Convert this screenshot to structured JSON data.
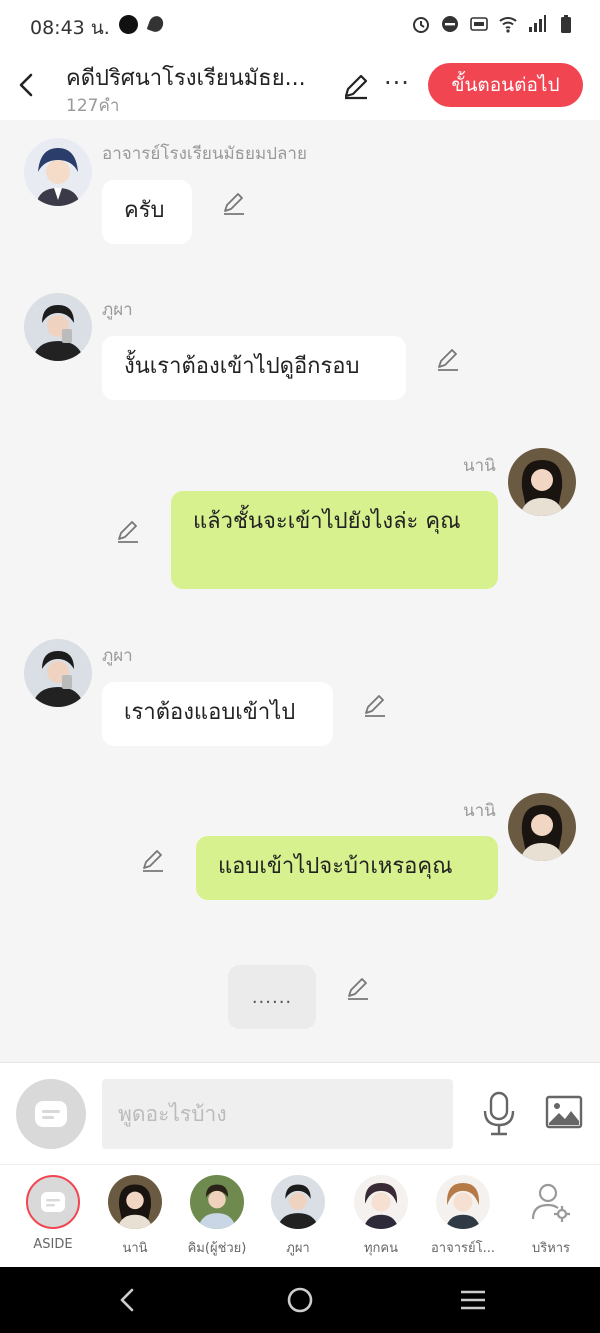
{
  "status": {
    "time": "08:43 น."
  },
  "header": {
    "title": "คดีปริศนาโรงเรียนมัธย...",
    "word_count": "127คำ",
    "next_label": "ขั้นตอนต่อไป"
  },
  "messages": [
    {
      "side": "left",
      "sender": "อาจารย์โรงเรียนมัธยมปลาย",
      "text": "ครับ"
    },
    {
      "side": "left",
      "sender": "ภูผา",
      "text": "งั้นเราต้องเข้าไปดูอีกรอบ"
    },
    {
      "side": "right",
      "sender": "นานิ",
      "text": "แล้วชั้นจะเข้าไปยังไงล่ะ คุณ"
    },
    {
      "side": "left",
      "sender": "ภูผา",
      "text": "เราต้องแอบเข้าไป"
    },
    {
      "side": "right",
      "sender": "นานิ",
      "text": "แอบเข้าไปจะบ้าเหรอคุณ"
    }
  ],
  "typing_text": "......",
  "input": {
    "placeholder": "พูดอะไรบ้าง"
  },
  "characters": [
    {
      "name": "ASIDE"
    },
    {
      "name": "นานิ"
    },
    {
      "name": "คิม(ผู้ช่วย)"
    },
    {
      "name": "ภูผา"
    },
    {
      "name": "ทุกคน"
    },
    {
      "name": "อาจารย์โ..."
    },
    {
      "name": "บริหาร"
    }
  ],
  "colors": {
    "accent": "#f24552",
    "outgoing_bubble": "#d6f18d",
    "incoming_bubble": "#ffffff",
    "background": "#f5f5f5"
  },
  "icons": [
    "back-icon",
    "pencil-icon",
    "more-icon",
    "mic-icon",
    "image-icon",
    "admin-icon",
    "home-nav-icon",
    "recents-nav-icon"
  ]
}
